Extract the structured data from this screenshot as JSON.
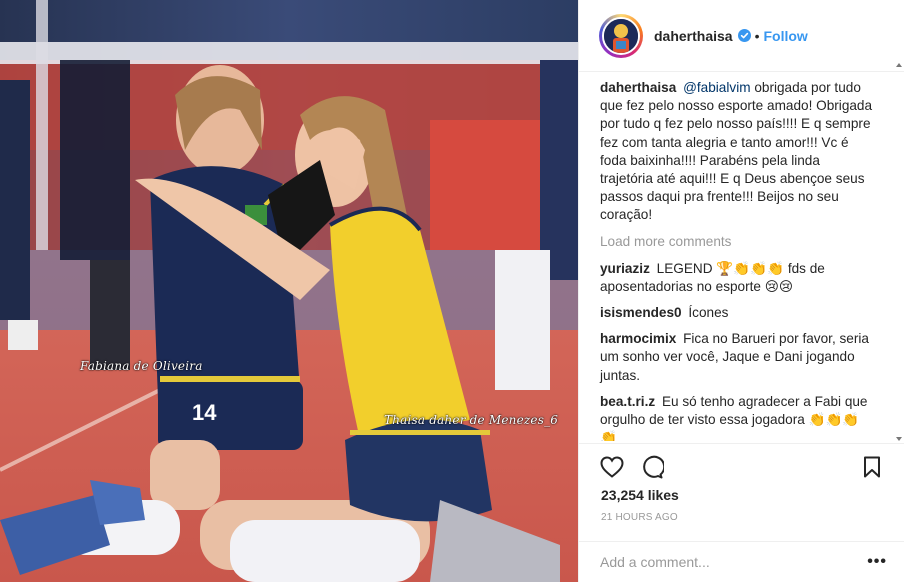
{
  "photo": {
    "jersey_number": "14",
    "watermark_left": "Fabiana de Oliveira",
    "watermark_right": "Thaisa daher de Menezes_6"
  },
  "header": {
    "username": "daherthaisa",
    "separator": "•",
    "follow_label": "Follow"
  },
  "caption": {
    "username": "daherthaisa",
    "mention": "@fabialvim",
    "text": "obrigada por tudo que fez pelo nosso esporte amado! Obrigada por tudo q fez pelo nosso país!!!! E q sempre fez com tanta alegria e tanto amor!!! Vc é foda baixinha!!!! Parabéns pela linda trajetória até aqui!!! E q Deus abençoe seus passos daqui pra frente!!! Beijos no seu coração!"
  },
  "load_more_label": "Load more comments",
  "comments": [
    {
      "username": "yuriaziz",
      "text": "LEGEND 🏆👏👏👏 fds de aposentadorias no esporte 😢😢"
    },
    {
      "username": "isismendes0",
      "text": "Ícones"
    },
    {
      "username": "harmocimix",
      "text": "Fica no Barueri por favor, seria um sonho ver você, Jaque e Dani jogando juntas."
    },
    {
      "username": "bea.t.ri.z",
      "text": "Eu só tenho agradecer a Fabi que orgulho de ter visto essa jogadora 👏👏👏 👏"
    }
  ],
  "likes": "23,254 likes",
  "timestamp": "21 HOURS AGO",
  "add_comment": {
    "placeholder": "Add a comment...",
    "more_label": "•••"
  },
  "icons": {
    "like": "heart-icon",
    "comment": "comment-icon",
    "save": "bookmark-icon",
    "verified": "verified-badge-icon"
  },
  "colors": {
    "link_blue": "#3897f0",
    "mention_blue": "#003569",
    "muted": "#999999",
    "text": "#262626",
    "border": "#efefef"
  }
}
